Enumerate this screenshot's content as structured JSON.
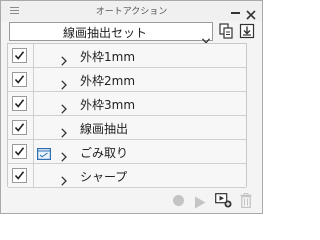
{
  "panel": {
    "title": "オートアクション",
    "menu_icon": "hamburger-menu-icon",
    "minimize_icon": "minimize-icon",
    "close_icon": "close-icon"
  },
  "set_selector": {
    "value": "線画抽出セット",
    "arrow_icon": "chevron-down-icon"
  },
  "set_buttons": {
    "copy_icon": "duplicate-set-icon",
    "import_icon": "import-set-icon"
  },
  "actions": [
    {
      "label": "外枠1mm",
      "checked": true,
      "dialog": false
    },
    {
      "label": "外枠2mm",
      "checked": true,
      "dialog": false
    },
    {
      "label": "外枠3mm",
      "checked": true,
      "dialog": false
    },
    {
      "label": "線画抽出",
      "checked": true,
      "dialog": false
    },
    {
      "label": "ごみ取り",
      "checked": true,
      "dialog": true
    },
    {
      "label": "シャープ",
      "checked": true,
      "dialog": false
    }
  ],
  "toolbar": {
    "record_icon": "record-icon",
    "play_icon": "play-icon",
    "add_action_icon": "add-auto-action-icon",
    "delete_icon": "trash-icon"
  },
  "colors": {
    "panel_bg": "#f4f4f4",
    "row_bg": "#f7f7f7",
    "text": "#222222",
    "disabled_icon": "#c4c4c4"
  }
}
